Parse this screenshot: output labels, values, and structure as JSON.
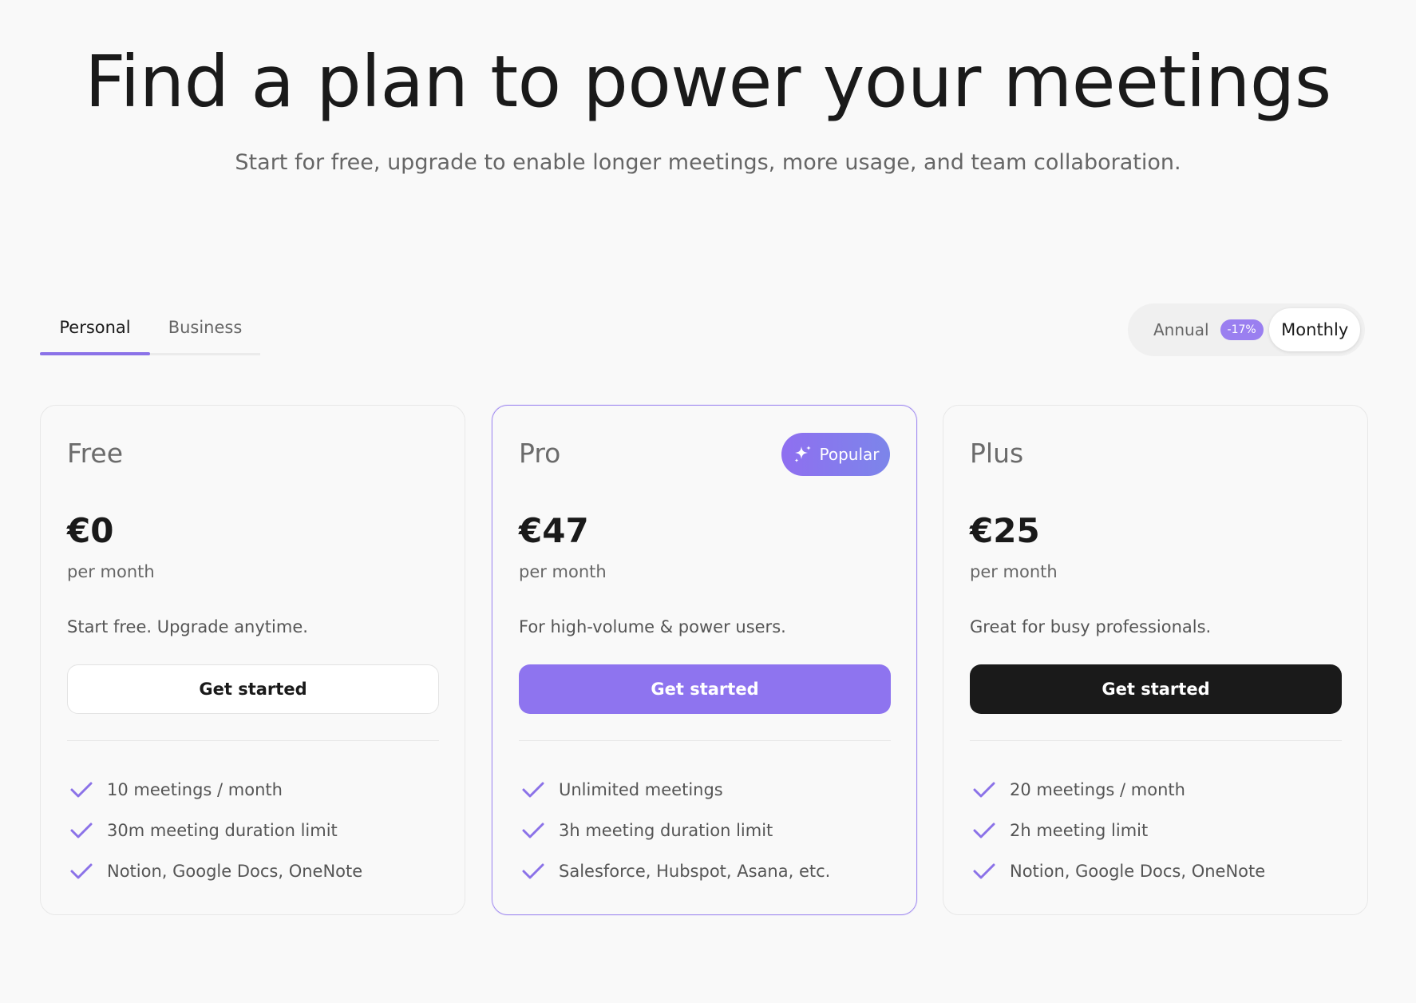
{
  "hero": {
    "title": "Find a plan to power your meetings",
    "subtitle": "Start for free, upgrade to enable longer meetings, more usage, and team collaboration."
  },
  "tabs": {
    "personal": "Personal",
    "business": "Business",
    "active": "Personal"
  },
  "billing": {
    "annual_label": "Annual",
    "annual_discount": "-17%",
    "monthly_label": "Monthly",
    "selected": "Monthly"
  },
  "colors": {
    "accent": "#8e74ef",
    "dark_button": "#1a1a1a",
    "check": "#8b72e8"
  },
  "plans": [
    {
      "name": "Free",
      "price": "€0",
      "period": "per month",
      "description": "Start free. Upgrade anytime.",
      "cta": "Get started",
      "features": [
        "10 meetings / month",
        "30m meeting duration limit",
        "Notion, Google Docs, OneNote"
      ]
    },
    {
      "name": "Pro",
      "badge": "Popular",
      "badge_icon": "sparkle-icon",
      "price": "€47",
      "period": "per month",
      "description": "For high-volume & power users.",
      "cta": "Get started",
      "features": [
        "Unlimited meetings",
        "3h meeting duration limit",
        "Salesforce, Hubspot, Asana, etc."
      ]
    },
    {
      "name": "Plus",
      "price": "€25",
      "period": "per month",
      "description": "Great for busy professionals.",
      "cta": "Get started",
      "features": [
        "20 meetings / month",
        "2h meeting limit",
        "Notion, Google Docs, OneNote"
      ]
    }
  ]
}
